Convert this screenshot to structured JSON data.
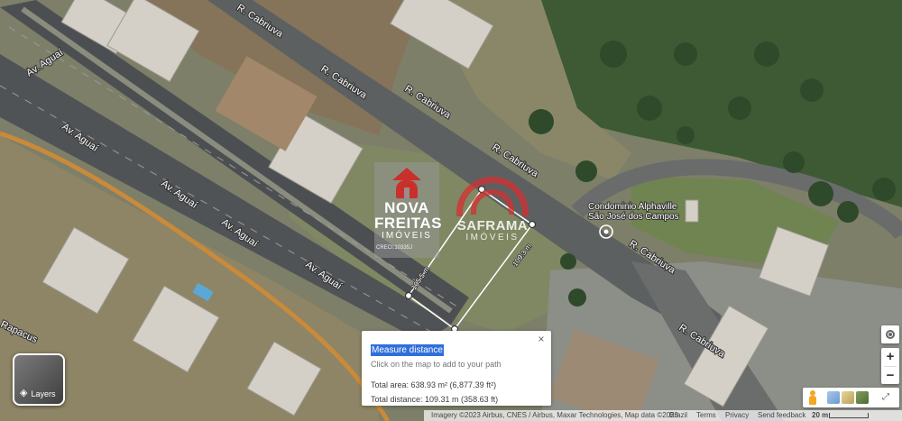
{
  "map": {
    "road_labels": [
      "R. Cabriuva",
      "R. Cabriuva",
      "R. Cabriuva",
      "R. Cabriuva",
      "R. Cabriuva",
      "R. Cabriuva",
      "Av. Aguaí",
      "Av. Aguaí",
      "Av. Aguaí",
      "Av. Aguaí",
      "Av. Aguaí",
      "Rapacus"
    ],
    "poi_name_line1": "Condominio Alphaville",
    "poi_name_line2": "São José dos Campos",
    "segment_labels": [
      "105.5 m",
      "109.3 m"
    ]
  },
  "watermarks": {
    "left": {
      "line1": "NOVA",
      "line2": "FREITAS",
      "line3": "IMÓVEIS",
      "creci": "CRECI:10335J"
    },
    "right": {
      "line1": "SAFRAMA",
      "line2": "IMÓVEIS"
    }
  },
  "layers_button": {
    "icon": "layers-icon",
    "label": "Layers"
  },
  "measure": {
    "title": "Measure distance",
    "hint": "Click on the map to add to your path",
    "total_area": "Total area: 638.93 m² (6,877.39 ft²)",
    "total_distance": "Total distance: 109.31 m (358.63 ft)",
    "close_glyph": "×"
  },
  "controls": {
    "zoom_in": "+",
    "zoom_out": "−",
    "expand_glyph": "⤢"
  },
  "footer": {
    "imagery": "Imagery ©2023 Airbus, CNES / Airbus, Maxar Technologies, Map data ©2023",
    "brazil": "Brazil",
    "terms": "Terms",
    "privacy": "Privacy",
    "feedback": "Send feedback",
    "scale": "20 m"
  },
  "colors": {
    "popup_highlight": "#2f6fdb",
    "measure_line": "#ffffff",
    "logo_red": "#c9302c"
  }
}
